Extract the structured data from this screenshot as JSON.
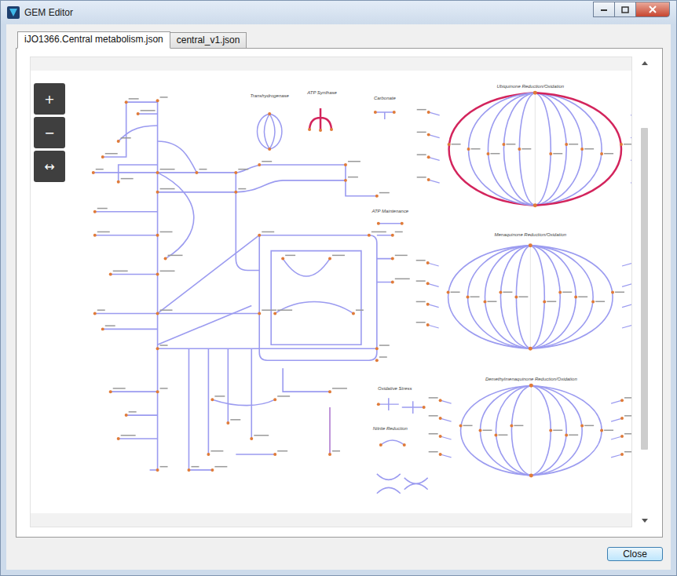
{
  "window": {
    "title": "GEM Editor"
  },
  "tabs": [
    {
      "label": "iJO1366.Central metabolism.json",
      "selected": true
    },
    {
      "label": "central_v1.json",
      "selected": false
    }
  ],
  "zoom_controls": [
    "+",
    "−",
    "↔"
  ],
  "map": {
    "sections": [
      {
        "title": "Transhydrogenase",
        "highlighted": false
      },
      {
        "title": "ATP Synthase",
        "highlighted": true
      },
      {
        "title": "Carbonate",
        "highlighted": false
      },
      {
        "title": "Ubiquinone Reduction/Oxidation",
        "highlighted": true
      },
      {
        "title": "ATP Maintenance",
        "highlighted": false
      },
      {
        "title": "Menaquinone Reduction/Oxidation",
        "highlighted": false
      },
      {
        "title": "Oxidative Stress",
        "highlighted": false
      },
      {
        "title": "Nitrite Reduction",
        "highlighted": false
      },
      {
        "title": "Demethylmenaquinone Reduction/Oxidation",
        "highlighted": false
      }
    ]
  },
  "buttons": [
    "Close"
  ]
}
